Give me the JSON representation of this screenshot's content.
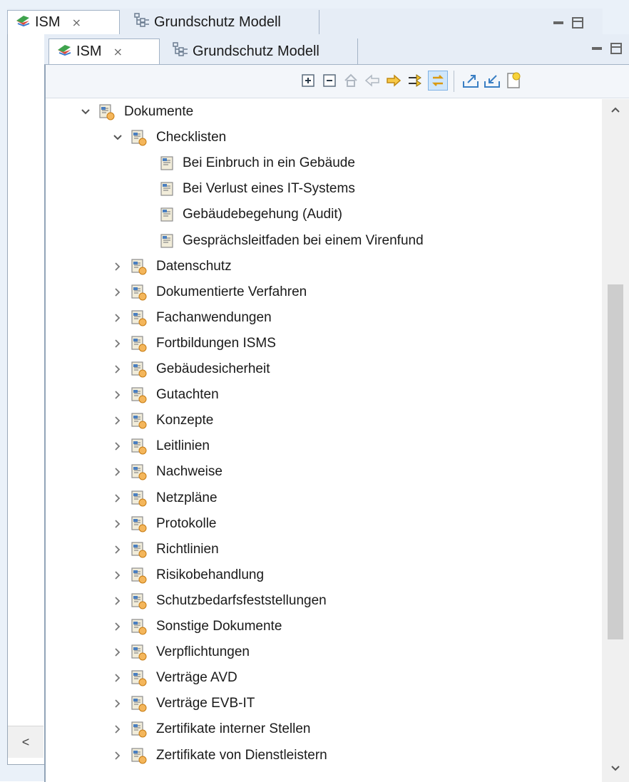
{
  "back_view": {
    "tabs": [
      {
        "label": "ISM",
        "icon": "ism-icon",
        "close": "⨯"
      },
      {
        "label": "Grundschutz Modell",
        "icon": "grundschutz-model-icon"
      }
    ],
    "scroll_left": "<"
  },
  "front_view": {
    "tabs": [
      {
        "label": "ISM",
        "icon": "ism-icon",
        "close": "⨯"
      },
      {
        "label": "Grundschutz Modell",
        "icon": "grundschutz-model-icon"
      }
    ],
    "toolbar": [
      {
        "name": "expand-all-icon"
      },
      {
        "name": "collapse-all-icon"
      },
      {
        "name": "home-icon"
      },
      {
        "name": "back-arrow-icon"
      },
      {
        "name": "forward-arrow-icon"
      },
      {
        "name": "link-filter-icon"
      },
      {
        "name": "link-with-editor-icon",
        "active": true
      },
      {
        "name": "export-icon"
      },
      {
        "name": "import-icon"
      },
      {
        "name": "new-note-icon"
      }
    ],
    "tree": [
      {
        "label": "Dokumente",
        "level": 0,
        "expanded": true,
        "type": "folder"
      },
      {
        "label": "Checklisten",
        "level": 1,
        "expanded": true,
        "type": "folder"
      },
      {
        "label": "Bei Einbruch in ein Gebäude",
        "level": 2,
        "type": "document"
      },
      {
        "label": "Bei Verlust eines IT-Systems",
        "level": 2,
        "type": "document"
      },
      {
        "label": "Gebäudebegehung (Audit)",
        "level": 2,
        "type": "document"
      },
      {
        "label": "Gesprächsleitfaden bei einem Virenfund",
        "level": 2,
        "type": "document"
      },
      {
        "label": "Datenschutz",
        "level": 1,
        "expanded": false,
        "type": "folder"
      },
      {
        "label": "Dokumentierte Verfahren",
        "level": 1,
        "expanded": false,
        "type": "folder"
      },
      {
        "label": "Fachanwendungen",
        "level": 1,
        "expanded": false,
        "type": "folder"
      },
      {
        "label": "Fortbildungen ISMS",
        "level": 1,
        "expanded": false,
        "type": "folder"
      },
      {
        "label": "Gebäudesicherheit",
        "level": 1,
        "expanded": false,
        "type": "folder"
      },
      {
        "label": "Gutachten",
        "level": 1,
        "expanded": false,
        "type": "folder"
      },
      {
        "label": "Konzepte",
        "level": 1,
        "expanded": false,
        "type": "folder"
      },
      {
        "label": "Leitlinien",
        "level": 1,
        "expanded": false,
        "type": "folder"
      },
      {
        "label": "Nachweise",
        "level": 1,
        "expanded": false,
        "type": "folder"
      },
      {
        "label": "Netzpläne",
        "level": 1,
        "expanded": false,
        "type": "folder"
      },
      {
        "label": "Protokolle",
        "level": 1,
        "expanded": false,
        "type": "folder"
      },
      {
        "label": "Richtlinien",
        "level": 1,
        "expanded": false,
        "type": "folder"
      },
      {
        "label": "Risikobehandlung",
        "level": 1,
        "expanded": false,
        "type": "folder"
      },
      {
        "label": "Schutzbedarfsfeststellungen",
        "level": 1,
        "expanded": false,
        "type": "folder"
      },
      {
        "label": "Sonstige Dokumente",
        "level": 1,
        "expanded": false,
        "type": "folder"
      },
      {
        "label": "Verpflichtungen",
        "level": 1,
        "expanded": false,
        "type": "folder"
      },
      {
        "label": "Verträge AVD",
        "level": 1,
        "expanded": false,
        "type": "folder"
      },
      {
        "label": "Verträge EVB-IT",
        "level": 1,
        "expanded": false,
        "type": "folder"
      },
      {
        "label": "Zertifikate interner Stellen",
        "level": 1,
        "expanded": false,
        "type": "folder"
      },
      {
        "label": "Zertifikate von Dienstleistern",
        "level": 1,
        "expanded": false,
        "type": "folder"
      }
    ]
  },
  "colors": {
    "folder_fill": "#f4b65b",
    "doc_fill": "#f1ecd9",
    "active_toolbar_bg": "#cfe6fb",
    "scroll_thumb": "#cdcdcd"
  }
}
